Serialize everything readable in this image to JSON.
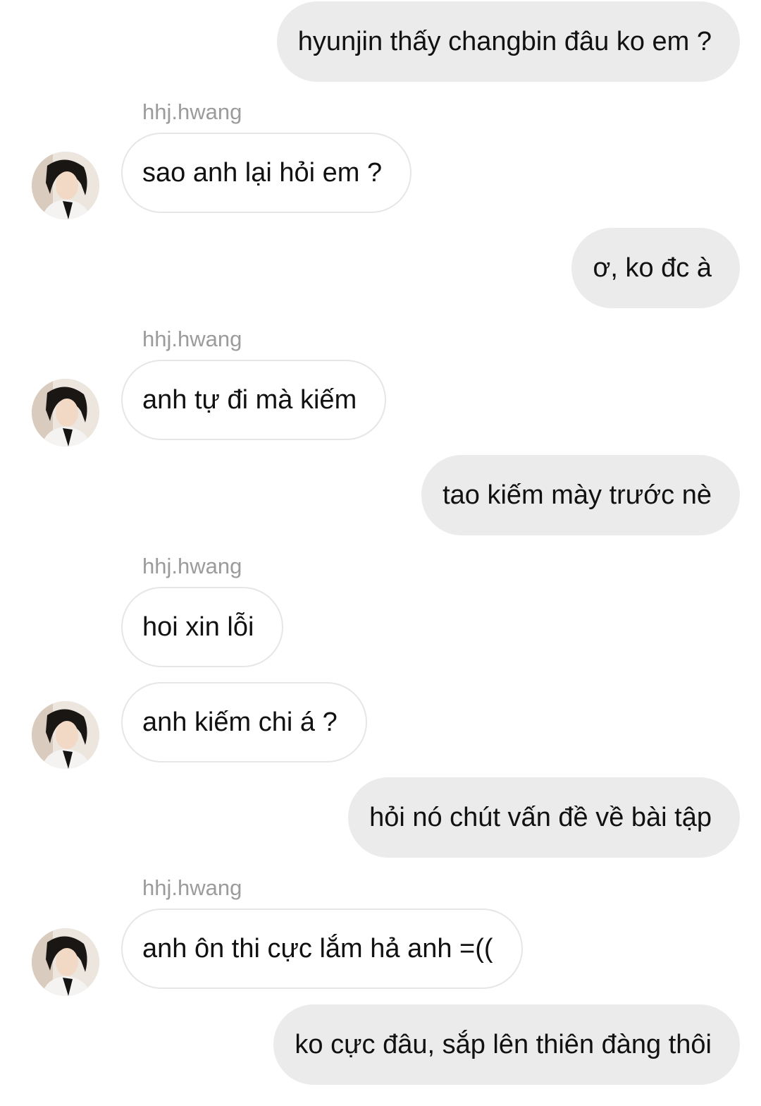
{
  "messages": [
    {
      "direction": "outgoing",
      "text": "hyunjin thấy changbin đâu ko em ?"
    },
    {
      "direction": "incoming",
      "sender": "hhj.hwang",
      "text": "sao anh lại hỏi em ?"
    },
    {
      "direction": "outgoing",
      "text": "ơ, ko đc à"
    },
    {
      "direction": "incoming",
      "sender": "hhj.hwang",
      "text": "anh tự đi mà kiếm"
    },
    {
      "direction": "outgoing",
      "text": "tao kiếm mày trước nè"
    },
    {
      "direction": "incoming",
      "sender": "hhj.hwang",
      "text": "hoi xin lỗi"
    },
    {
      "direction": "incoming",
      "text": "anh kiếm chi á ?"
    },
    {
      "direction": "outgoing",
      "text": "hỏi nó chút vấn đề về bài tập"
    },
    {
      "direction": "incoming",
      "sender": "hhj.hwang",
      "text": "anh ôn thi cực lắm hả anh =(("
    },
    {
      "direction": "outgoing",
      "text": "ko cực đâu, sắp lên thiên đàng thôi"
    }
  ],
  "avatar_icon": "profile-photo-avatar",
  "colors": {
    "outgoing_bubble": "#ebebeb",
    "incoming_bubble_border": "#e6e6e6",
    "sender_name": "#9b9b9b",
    "text": "#111111"
  }
}
